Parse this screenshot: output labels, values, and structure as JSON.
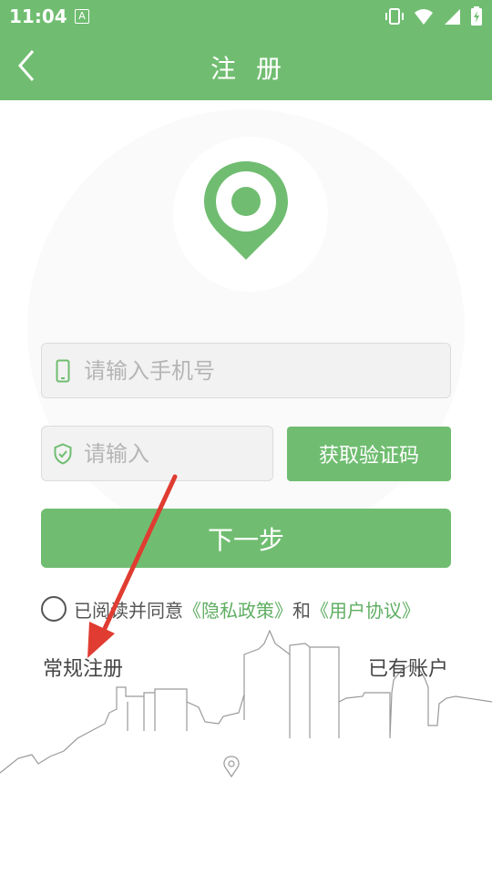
{
  "status_bar": {
    "time": "11:04",
    "indicator": "A"
  },
  "app_bar": {
    "title": "注册",
    "back_icon": "chevron-left-icon"
  },
  "form": {
    "phone_placeholder": "请输入手机号",
    "code_placeholder": "请输入",
    "get_code_label": "获取验证码",
    "next_label": "下一步"
  },
  "agreement": {
    "prefix": "已阅读并同意",
    "privacy_link": "《隐私政策》",
    "conjunction": "和",
    "user_link": "《用户协议》"
  },
  "footer": {
    "normal_register": "常规注册",
    "have_account": "已有账户"
  },
  "colors": {
    "brand_green": "#70bd71",
    "link_green": "#5fae62",
    "annotation_red": "#e03c31"
  }
}
